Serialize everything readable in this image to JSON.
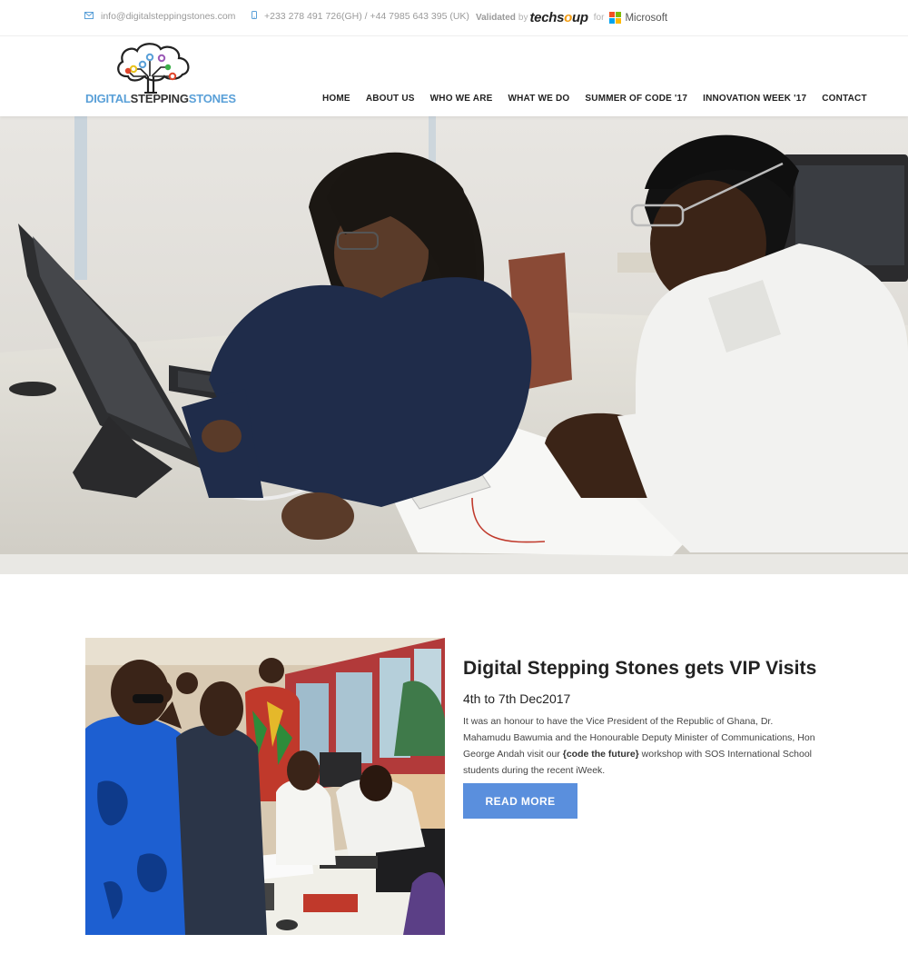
{
  "topbar": {
    "email": "info@digitalsteppingstones.com",
    "phone": "+233 278 491 726(GH)  /  +44 7985 643 395 (UK)",
    "validated_label": "Validated",
    "validated_by": "by",
    "techsoup_a": "techs",
    "techsoup_o": "o",
    "techsoup_b": "up",
    "validated_for": "for",
    "microsoft": "Microsoft",
    "ms_colors": [
      "#f25022",
      "#7fba00",
      "#00a4ef",
      "#ffb900"
    ]
  },
  "header": {
    "logo_text_a": "DIGITAL",
    "logo_text_b": "STEPPING",
    "logo_text_c": "STONES",
    "nav": [
      "HOME",
      "ABOUT US",
      "WHO WE ARE",
      "WHAT WE DO",
      "SUMMER OF CODE '17",
      "INNOVATION WEEK '17",
      "CONTACT"
    ]
  },
  "news": {
    "title": "Digital Stepping Stones gets VIP Visits",
    "date": "4th to 7th Dec2017",
    "body_1": "It was an honour to have the Vice President of the Republic of Ghana, Dr. Mahamudu Bawumia and the Honourable Deputy Minister of Communications, Hon George Andah visit our ",
    "body_bold": "{code the future}",
    "body_2": " workshop with SOS International School students during the recent iWeek.",
    "button": "READ MORE"
  },
  "colors": {
    "accent": "#5a8fdd",
    "logo_blue": "#5aa0d8"
  }
}
